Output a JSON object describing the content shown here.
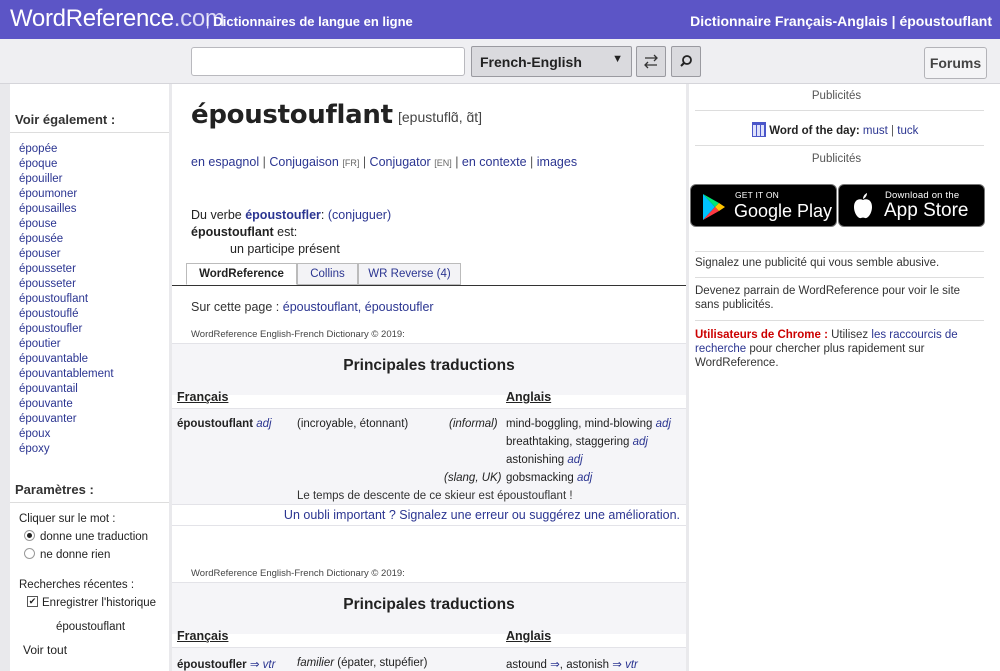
{
  "header": {
    "logo_main": "WordReference",
    "logo_suffix": ".com",
    "tagline_sep": "|",
    "tagline": "Dictionnaires de langue en ligne",
    "right_title": "Dictionnaire Français-Anglais | époustouflant"
  },
  "search": {
    "value": "",
    "placeholder": "",
    "language": "French-English",
    "swap_icon": "swap-icon",
    "search_icon": "search-icon",
    "forums_label": "Forums"
  },
  "sidebar": {
    "see_also_title": "Voir également :",
    "see_also": [
      "épopée",
      "époque",
      "épouiller",
      "époumoner",
      "épousailles",
      "épouse",
      "épousée",
      "épouser",
      "épousseter",
      "épousseter",
      "époustouflant",
      "époustouflé",
      "époustoufler",
      "époutier",
      "épouvantable",
      "épouvantablement",
      "épouvantail",
      "épouvante",
      "épouvanter",
      "époux",
      "époxy"
    ],
    "params_title": "Paramètres :",
    "click_word_label": "Cliquer sur le mot :",
    "radio_translate": "donne une traduction",
    "radio_nothing": "ne donne rien",
    "recent_label": "Recherches récentes :",
    "save_history": "Enregistrer l'historique",
    "recent_item": "époustouflant",
    "see_all": "Voir tout"
  },
  "entry": {
    "headword": "époustouflant",
    "pronunciation": "[epustuflɑ̃, ɑ̃t]",
    "links": {
      "spanish": "en espagnol",
      "conjugaison": "Conjugaison",
      "conjugaison_tag": "[FR]",
      "conjugator": "Conjugator",
      "conjugator_tag": "[EN]",
      "context": "en contexte",
      "images": "images",
      "sep": "|"
    },
    "verb_prefix": "Du verbe",
    "verb": "époustoufler",
    "verb_colon": ":",
    "conjugate": "(conjuguer)",
    "est_word": "époustouflant",
    "est_suffix": "est:",
    "participle": "un participe présent"
  },
  "tabs": [
    {
      "label": "WordReference"
    },
    {
      "label": "Collins"
    },
    {
      "label": "WR Reverse (4)"
    }
  ],
  "on_page": {
    "label": "Sur cette page :",
    "items": "époustouflant, époustoufler"
  },
  "section1": {
    "copyright": "WordReference English-French Dictionary © 2019:",
    "title": "Principales traductions",
    "col_fr": "Français",
    "col_en": "Anglais",
    "fr_word": "époustouflant",
    "fr_pos": "adj",
    "note": "(incroyable, étonnant)",
    "reg1": "(informal)",
    "tr1": "mind-boggling, mind-blowing",
    "tr1_pos": "adj",
    "tr2": "breathtaking, staggering",
    "tr2_pos": "adj",
    "tr3": "astonishing",
    "tr3_pos": "adj",
    "reg4": "(slang, UK)",
    "tr4": "gobsmacking",
    "tr4_pos": "adj",
    "example": "Le temps de descente de ce skieur est époustouflant !",
    "report": "Un oubli important ? Signalez une erreur ou suggérez une amélioration."
  },
  "section2": {
    "copyright": "WordReference English-French Dictionary © 2019:",
    "title": "Principales traductions",
    "col_fr": "Français",
    "col_en": "Anglais",
    "fr_word": "époustoufler",
    "fr_pos": "⇒ vtr",
    "note_reg": "familier",
    "note": "(épater, stupéfier)",
    "tr1": "astound",
    "tr1_arrow": "⇒",
    "tr1_sep": ",",
    "tr2": "astonish",
    "tr2_pos": "⇒ vtr"
  },
  "right": {
    "pub1": "Publicités",
    "wotd_icon": "calendar-icon",
    "wotd_label": "Word of the day:",
    "wotd_word1": "must",
    "wotd_sep": "|",
    "wotd_word2": "tuck",
    "pub2": "Publicités",
    "google_small": "GET IT ON",
    "google_big": "Google Play",
    "apple_small": "Download on the",
    "apple_big": "App Store",
    "report_ad": "Signalez une publicité qui vous semble abusive.",
    "sponsor": "Devenez parrain de WordReference pour voir le site sans publicités.",
    "chrome_label": "Utilisateurs de Chrome :",
    "chrome_pre": "Utilisez",
    "chrome_link": "les raccourcis de recherche",
    "chrome_post": "pour chercher plus rapidement sur WordReference."
  }
}
